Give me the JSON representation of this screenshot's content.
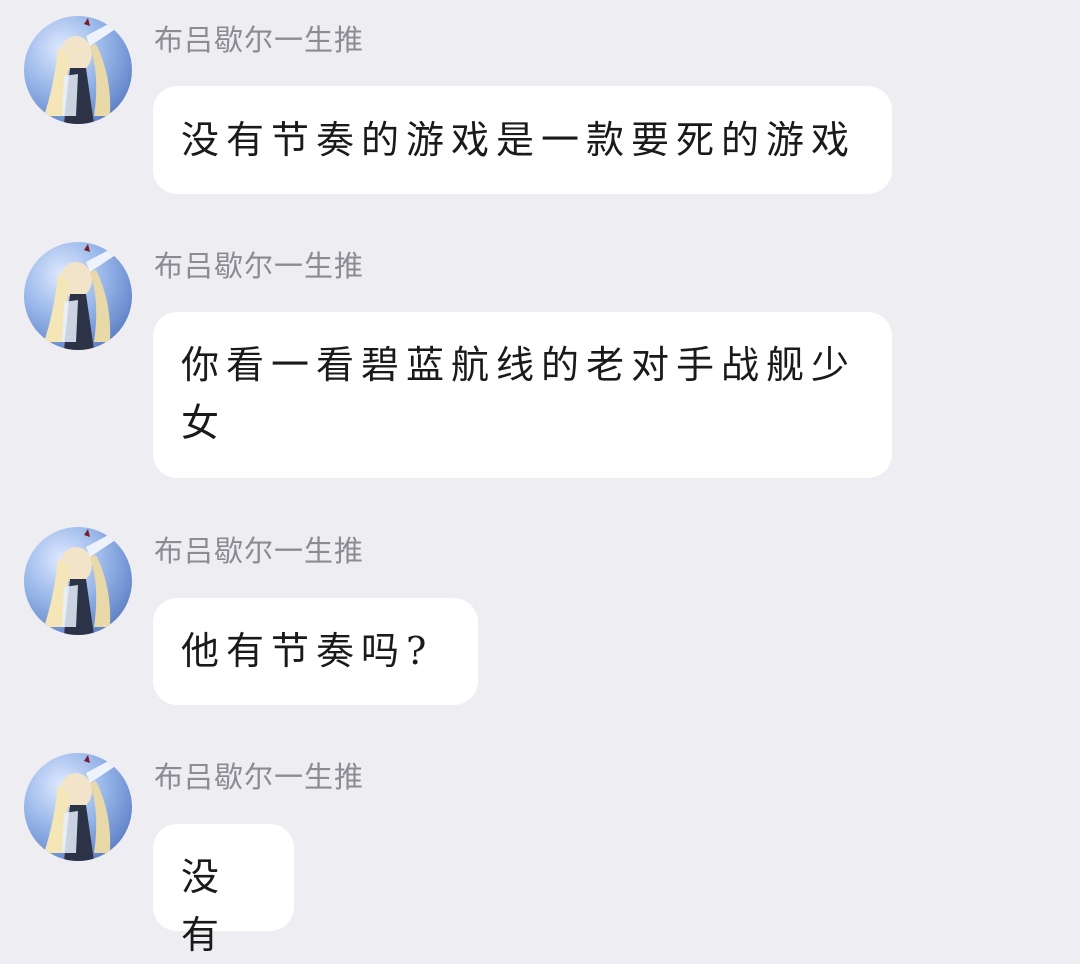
{
  "messages": [
    {
      "sender": "布吕歇尔一生推",
      "text": "没有节奏的游戏是一款要死的游戏"
    },
    {
      "sender": "布吕歇尔一生推",
      "text": "你看一看碧蓝航线的老对手战舰少女"
    },
    {
      "sender": "布吕歇尔一生推",
      "text": "他有节奏吗?"
    },
    {
      "sender": "布吕歇尔一生推",
      "text": "没有"
    }
  ],
  "colors": {
    "background": "#ededf2",
    "bubble": "#ffffff",
    "sender_name": "#8b8b92",
    "message_text": "#1a1a1a"
  },
  "icons": {
    "avatar": "anime-character-avatar"
  }
}
